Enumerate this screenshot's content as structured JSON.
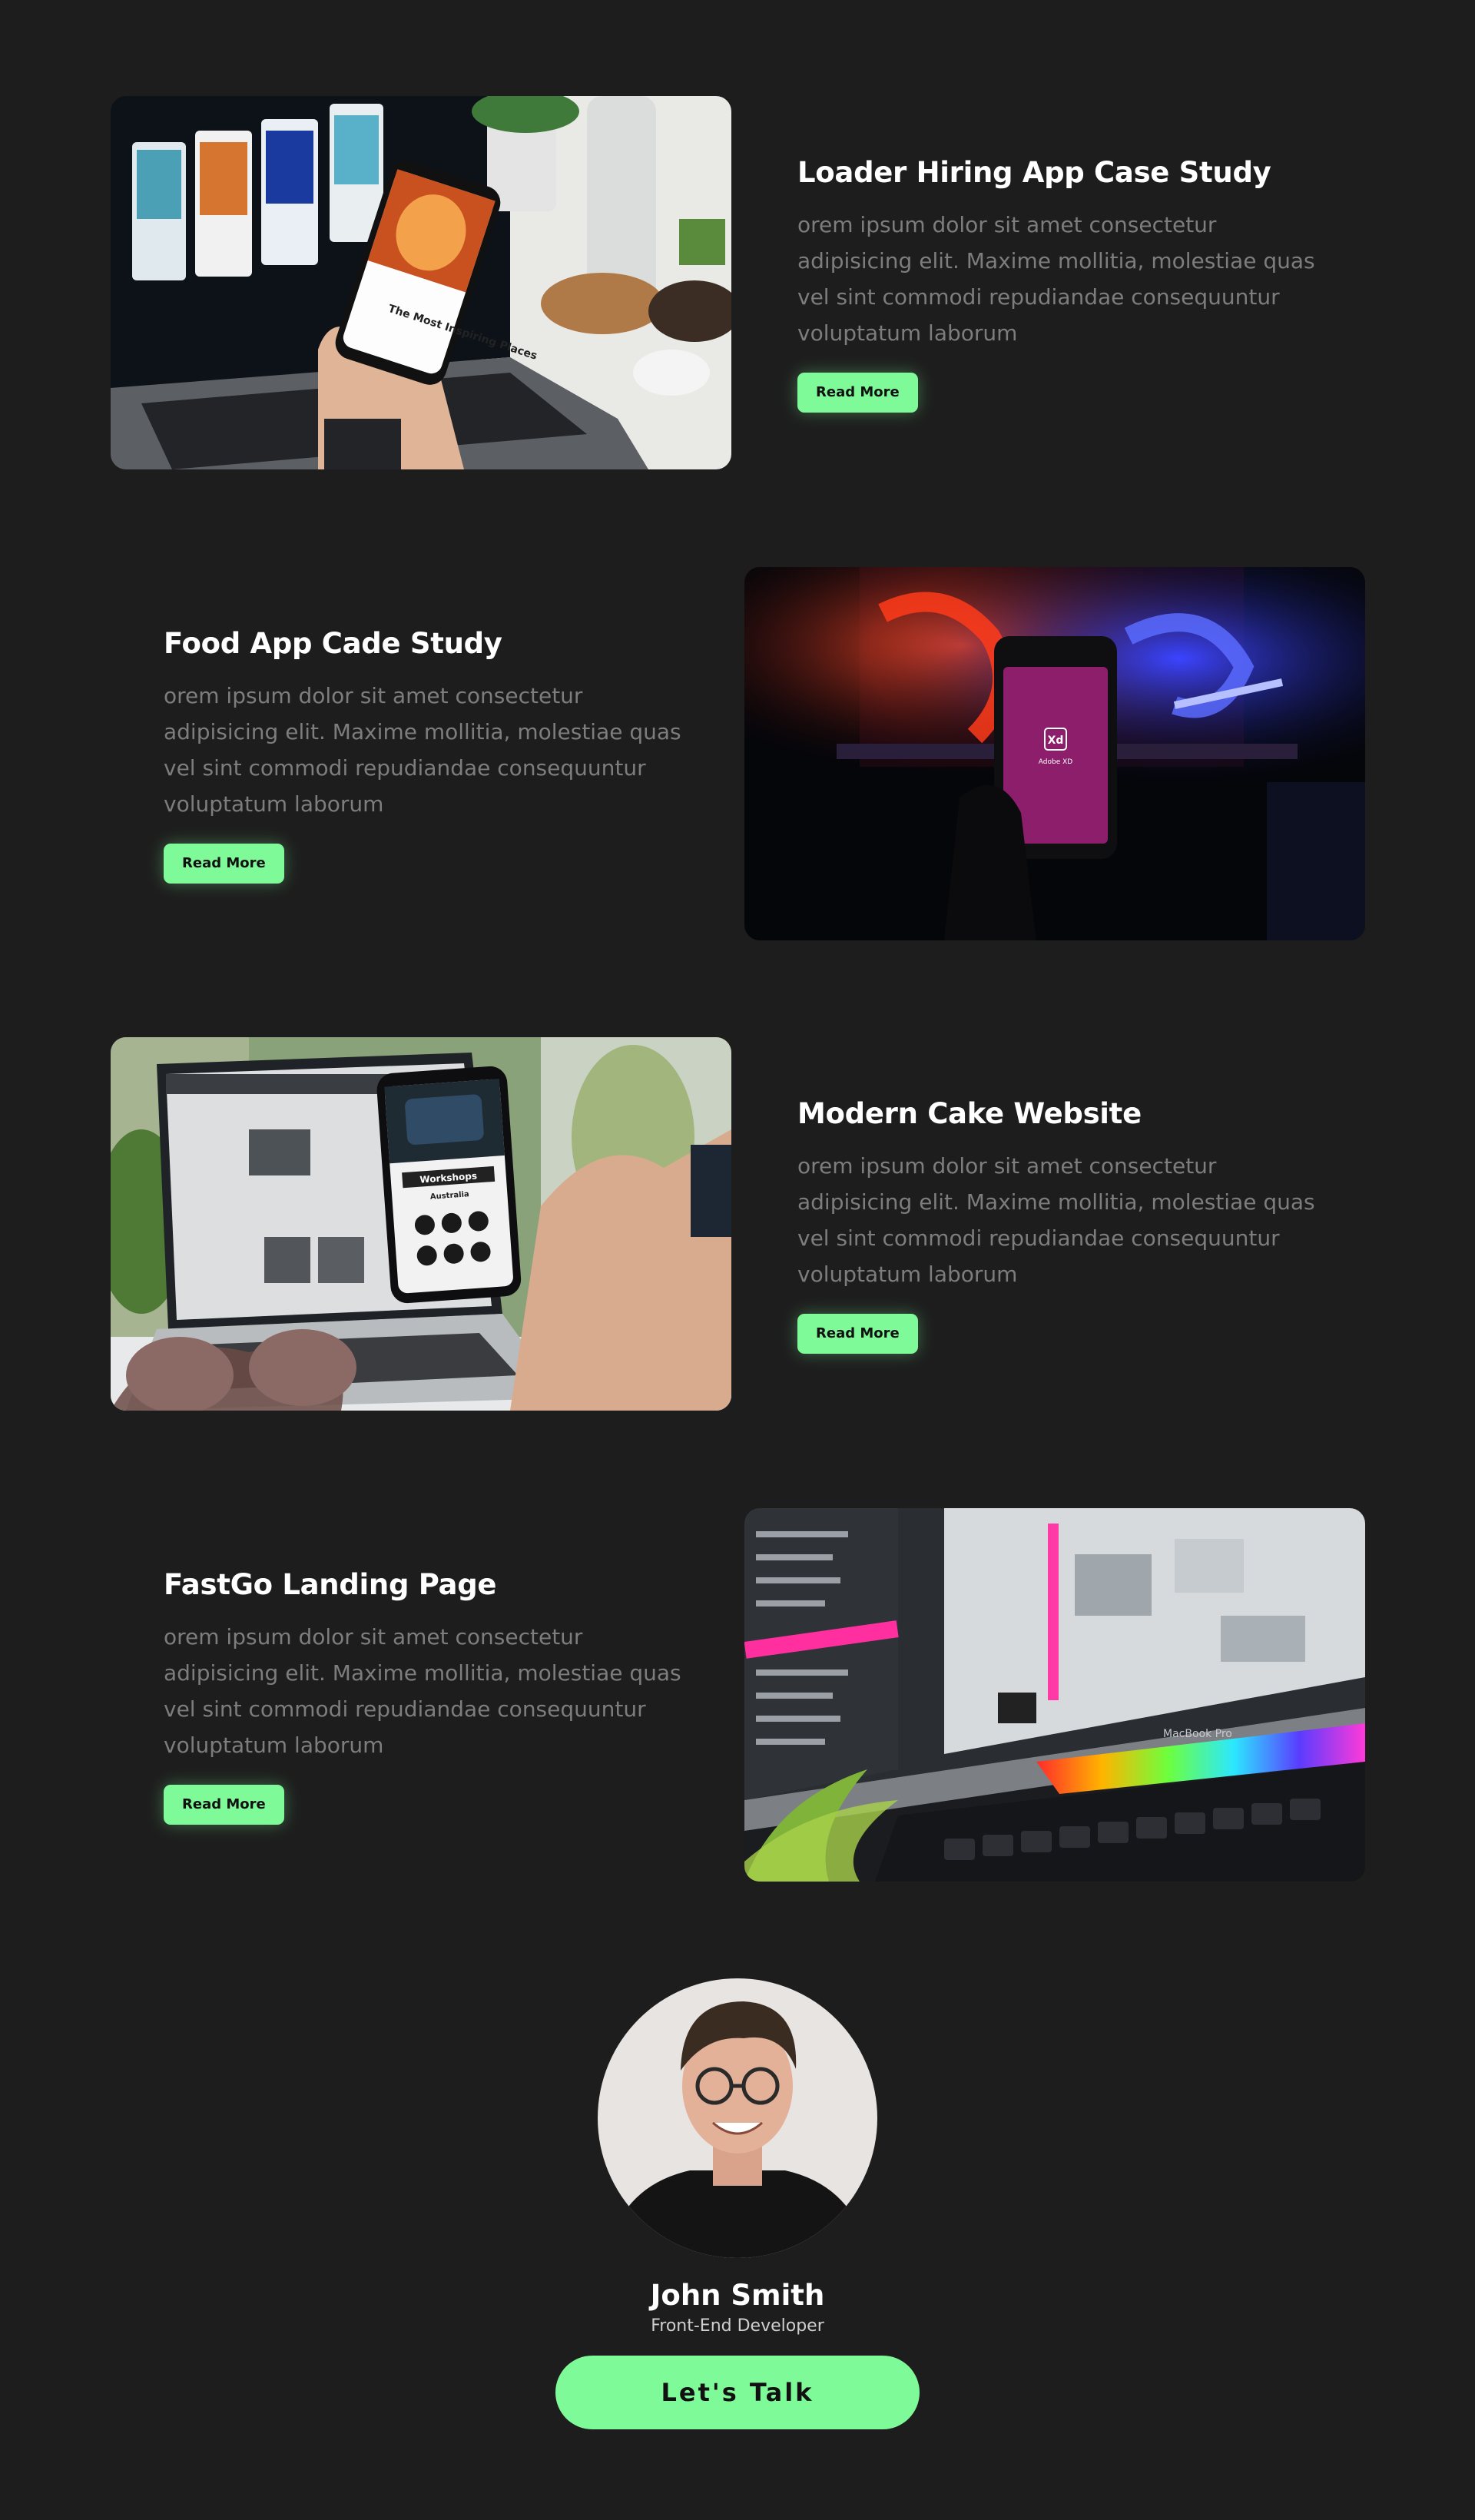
{
  "projects": [
    {
      "title": "Loader Hiring App Case Study",
      "description": "orem ipsum dolor sit amet consectetur adipisicing elit. Maxime mollitia, molestiae quas vel sint commodi repudiandae consequuntur voluptatum laborum",
      "button": "Read More",
      "image_alt": "hand holding phone in front of laptop with app screens"
    },
    {
      "title": "Food App Cade Study",
      "description": "orem ipsum dolor sit amet consectetur adipisicing elit. Maxime mollitia, molestiae quas vel sint commodi repudiandae consequuntur voluptatum laborum",
      "button": "Read More",
      "image_alt": "phone showing Adobe XD in front of neon light"
    },
    {
      "title": "Modern Cake Website",
      "description": "orem ipsum dolor sit amet consectetur adipisicing elit. Maxime mollitia, molestiae quas vel sint commodi repudiandae consequuntur voluptatum laborum",
      "button": "Read More",
      "image_alt": "phone with camera app in front of laptop and sunglasses"
    },
    {
      "title": "FastGo Landing Page",
      "description": "orem ipsum dolor sit amet consectetur adipisicing elit. Maxime mollitia, molestiae quas vel sint commodi repudiandae consequuntur voluptatum laborum",
      "button": "Read More",
      "image_alt": "MacBook Pro with design software and touch bar"
    }
  ],
  "image_texts": {
    "p1_phone": "The Most Inspiring Places",
    "p2_app": "Xd",
    "p2_app_name": "Adobe XD",
    "p3_header": "Workshops",
    "p3_sub": "Australia",
    "p4_macbook": "MacBook Pro"
  },
  "profile": {
    "name": "John Smith",
    "role": "Front-End Developer",
    "cta": "Let's Talk"
  },
  "colors": {
    "background": "#1d1d1d",
    "accent": "#7ffa98",
    "muted_text": "#7d7d7d"
  }
}
